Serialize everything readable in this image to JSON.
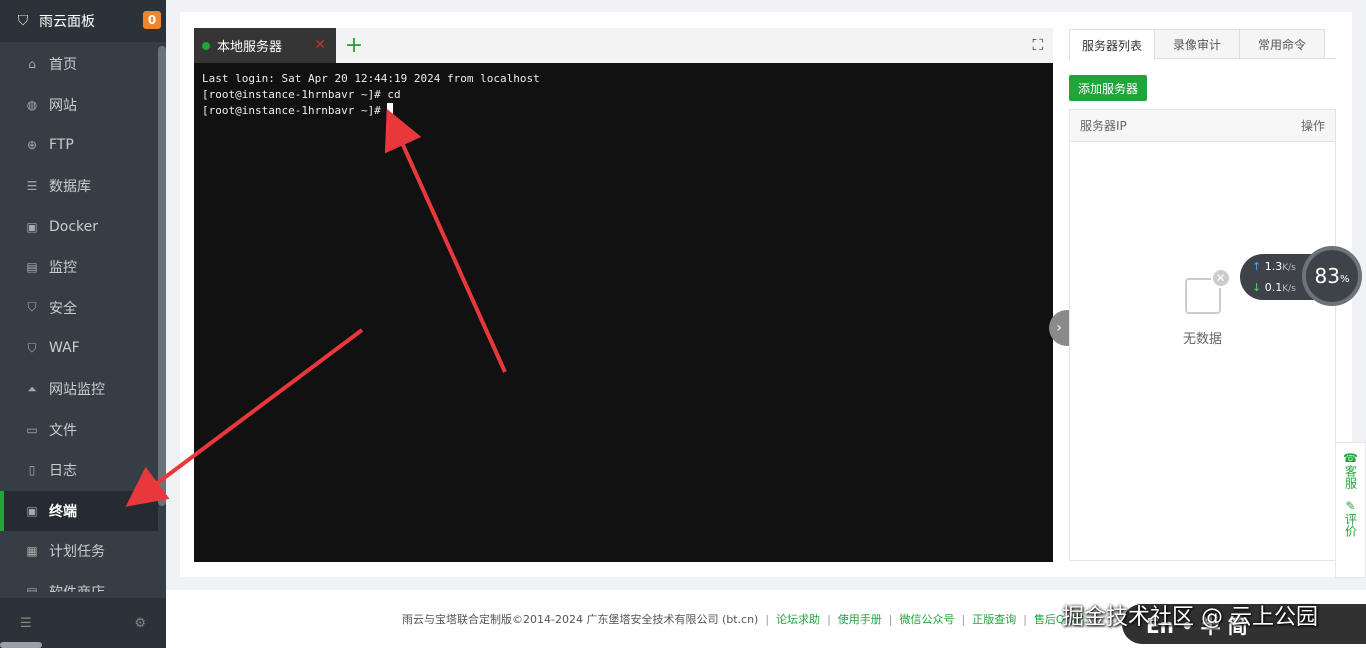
{
  "brand": {
    "title": "雨云面板",
    "badge": "0"
  },
  "menu": [
    {
      "label": "首页",
      "icon": "home-icon"
    },
    {
      "label": "网站",
      "icon": "globe-icon"
    },
    {
      "label": "FTP",
      "icon": "ftp-icon"
    },
    {
      "label": "数据库",
      "icon": "database-icon"
    },
    {
      "label": "Docker",
      "icon": "docker-icon"
    },
    {
      "label": "监控",
      "icon": "monitor-icon"
    },
    {
      "label": "安全",
      "icon": "shield-icon"
    },
    {
      "label": "WAF",
      "icon": "waf-icon"
    },
    {
      "label": "网站监控",
      "icon": "chart-icon"
    },
    {
      "label": "文件",
      "icon": "folder-icon"
    },
    {
      "label": "日志",
      "icon": "log-icon"
    },
    {
      "label": "终端",
      "icon": "terminal-icon",
      "active": true
    },
    {
      "label": "计划任务",
      "icon": "calendar-icon"
    },
    {
      "label": "软件商店",
      "icon": "store-icon"
    }
  ],
  "terminal": {
    "tab_label": "本地服务器",
    "lines": [
      "Last login: Sat Apr 20 12:44:19 2024 from localhost",
      "[root@instance-1hrnbavr ~]# cd",
      "[root@instance-1hrnbavr ~]# "
    ]
  },
  "right_panel": {
    "tabs": [
      "服务器列表",
      "录像审计",
      "常用命令"
    ],
    "add_button": "添加服务器",
    "col_ip": "服务器IP",
    "col_action": "操作",
    "empty_text": "无数据"
  },
  "net": {
    "up": "1.3",
    "down": "0.1",
    "unit": "K/s",
    "cpu": "83",
    "cpu_unit": "%"
  },
  "feedback": {
    "service": "客服",
    "review": "评价"
  },
  "footer": {
    "copyright": "雨云与宝塔联合定制版©2014-2024 广东堡塔安全技术有限公司 (bt.cn)",
    "links": [
      "论坛求助",
      "使用手册",
      "微信公众号",
      "正版查询",
      "售后QQ群:"
    ]
  },
  "watermark": "掘金技术社区 @ 云上公园",
  "ime": "En • 半 简",
  "colors": {
    "accent": "#20a53a",
    "sidebar": "#363e45",
    "terminal_bg": "#111111"
  }
}
